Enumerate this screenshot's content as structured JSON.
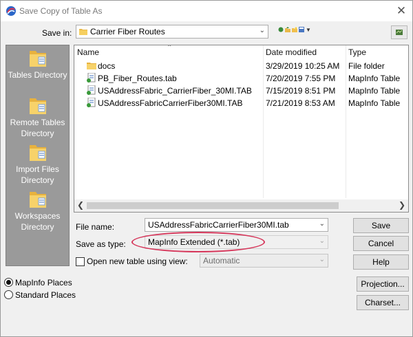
{
  "window": {
    "title": "Save Copy of Table As",
    "close_label": "✕"
  },
  "save_in": {
    "label": "Save in:",
    "value": "Carrier Fiber Routes"
  },
  "places": [
    {
      "label": "Tables Directory"
    },
    {
      "label": "Remote Tables Directory"
    },
    {
      "label": "Import Files Directory"
    },
    {
      "label": "Workspaces Directory"
    }
  ],
  "file_list": {
    "columns": {
      "name": "Name",
      "date": "Date modified",
      "type": "Type"
    },
    "rows": [
      {
        "name": "docs",
        "date": "3/29/2019 10:25 AM",
        "type": "File folder",
        "icon": "folder-icon"
      },
      {
        "name": "PB_Fiber_Routes.tab",
        "date": "7/20/2019 7:55 PM",
        "type": "MapInfo Table",
        "icon": "table-file-icon"
      },
      {
        "name": "USAddressFabric_CarrierFiber_30MI.TAB",
        "date": "7/15/2019 8:51 PM",
        "type": "MapInfo Table",
        "icon": "table-file-icon"
      },
      {
        "name": "USAddressFabricCarrierFiber30MI.TAB",
        "date": "7/21/2019 8:53 AM",
        "type": "MapInfo Table",
        "icon": "table-file-icon"
      }
    ]
  },
  "form": {
    "file_name_label": "File name:",
    "file_name_value": "USAddressFabricCarrierFiber30MI.tab",
    "save_as_type_label": "Save as type:",
    "save_as_type_value": "MapInfo Extended (*.tab)",
    "open_new_table_label": "Open new table using view:",
    "view_value": "Automatic"
  },
  "buttons": {
    "save": "Save",
    "cancel": "Cancel",
    "help": "Help",
    "projection": "Projection...",
    "charset": "Charset..."
  },
  "place_options": {
    "mapinfo": "MapInfo Places",
    "standard": "Standard Places",
    "selected": "MapInfo Places"
  },
  "colors": {
    "highlight": "#d6375b",
    "places_panel": "#9a9a9a"
  }
}
